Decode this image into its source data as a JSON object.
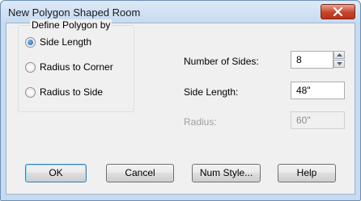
{
  "window": {
    "title": "New Polygon Shaped Room"
  },
  "define_group": {
    "legend": "Define Polygon by",
    "options": [
      {
        "label": "Side Length",
        "checked": true
      },
      {
        "label": "Radius to Corner",
        "checked": false
      },
      {
        "label": "Radius to Side",
        "checked": false
      }
    ]
  },
  "fields": {
    "num_sides": {
      "label": "Number of Sides:",
      "value": "8"
    },
    "side_length": {
      "label": "Side Length:",
      "value": "48\""
    },
    "radius": {
      "label": "Radius:",
      "value": "60\""
    }
  },
  "buttons": {
    "ok": "OK",
    "cancel": "Cancel",
    "num_style": "Num Style...",
    "help": "Help"
  },
  "icons": {
    "close": "close-icon",
    "spin_up": "arrow-up-icon",
    "spin_down": "arrow-down-icon"
  },
  "colors": {
    "titlebar": "#c6daf1",
    "close_button": "#c7442a",
    "default_button_border": "#3c7fb1"
  }
}
